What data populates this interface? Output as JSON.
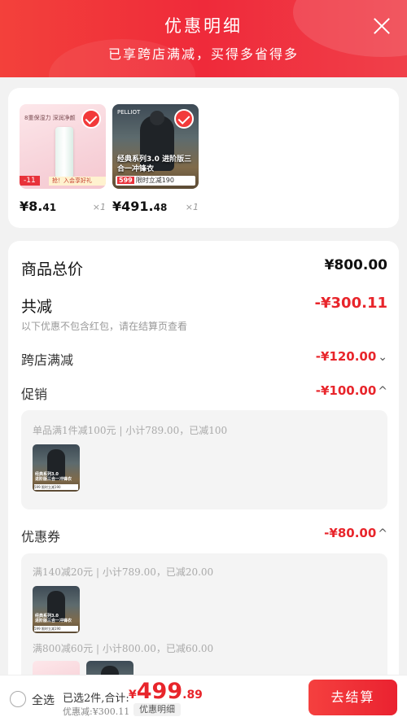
{
  "header": {
    "title": "优惠明细",
    "subtitle": "已享跨店满减，买得多省得多"
  },
  "products": [
    {
      "image_text": "8重保湿力 深润净颜",
      "badge": "-11",
      "banner": "抢！入会享好礼",
      "price_main": "¥8.",
      "price_dec": "41",
      "qty": "×1"
    },
    {
      "image_text": "经典系列3.0 进阶版三合一冲锋衣",
      "brand": "PELLIOT",
      "badge": "599",
      "banner": "限时立减190",
      "price_main": "¥491.",
      "price_dec": "48",
      "qty": "×1"
    }
  ],
  "summary": {
    "total_label": "商品总价",
    "total_value": "¥800.00",
    "reduce_label": "共减",
    "reduce_value": "-¥300.11",
    "note": "以下优惠不包含红包，请在结算页查看",
    "cross_store_label": "跨店满减",
    "cross_store_value": "-¥120.00",
    "promo_label": "促销",
    "promo_value": "-¥100.00",
    "promo_detail": "单品满1件减100元 | 小计789.00，已减100",
    "coupon_label": "优惠券",
    "coupon_value": "-¥80.00",
    "coupon_detail_1": "满140减20元 | 小计789.00，已减20.00",
    "coupon_detail_2": "满800减60元 | 小计800.00，已减60.00"
  },
  "bottom": {
    "select_all": "全选",
    "total_label": "已选2件,合计:",
    "currency": "¥",
    "total_int": "499",
    "total_dec": ".89",
    "saved": "优惠减:¥300.11",
    "detail_button": "优惠明细",
    "checkout_button": "去结算"
  },
  "icons": {
    "close": "close-icon",
    "check": "check-icon",
    "chevron_down": "chevron-down-icon",
    "chevron_up": "chevron-up-icon"
  },
  "colors": {
    "accent": "#e8252b",
    "header": "#f0333c"
  }
}
